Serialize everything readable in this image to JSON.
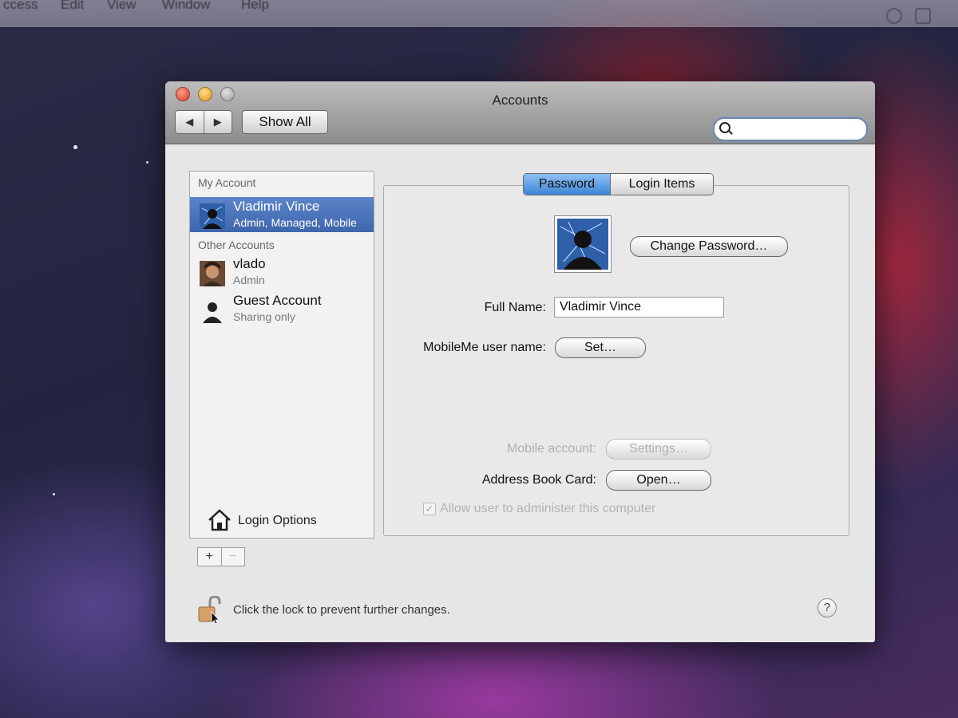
{
  "menubar": {
    "items": [
      "ccess",
      "Edit",
      "View",
      "Window",
      "Help"
    ]
  },
  "window": {
    "title": "Accounts",
    "show_all": "Show All",
    "nav_back": "◀",
    "nav_forward": "▶",
    "search_placeholder": ""
  },
  "sidebar": {
    "my_account_header": "My Account",
    "other_accounts_header": "Other Accounts",
    "accounts": [
      {
        "name": "Vladimir Vince",
        "sub": "Admin, Managed, Mobile"
      },
      {
        "name": "vlado",
        "sub": "Admin"
      },
      {
        "name": "Guest Account",
        "sub": "Sharing only"
      }
    ],
    "login_options": "Login Options",
    "add": "+",
    "remove": "−"
  },
  "tabs": {
    "password": "Password",
    "login_items": "Login Items"
  },
  "form": {
    "change_password": "Change Password…",
    "full_name_label": "Full Name:",
    "full_name_value": "Vladimir Vince",
    "mobileme_label": "MobileMe user name:",
    "mobileme_button": "Set…",
    "mobile_account_label": "Mobile account:",
    "mobile_account_button": "Settings…",
    "address_book_label": "Address Book Card:",
    "address_book_button": "Open…",
    "admin_checkbox_label": "Allow user to administer this computer",
    "admin_checkbox_mark": "✓"
  },
  "footer": {
    "lock_message": "Click the lock to prevent further changes.",
    "help": "?"
  },
  "colors": {
    "selection": "#4a72b8",
    "tab_active": "#5a9be0"
  }
}
